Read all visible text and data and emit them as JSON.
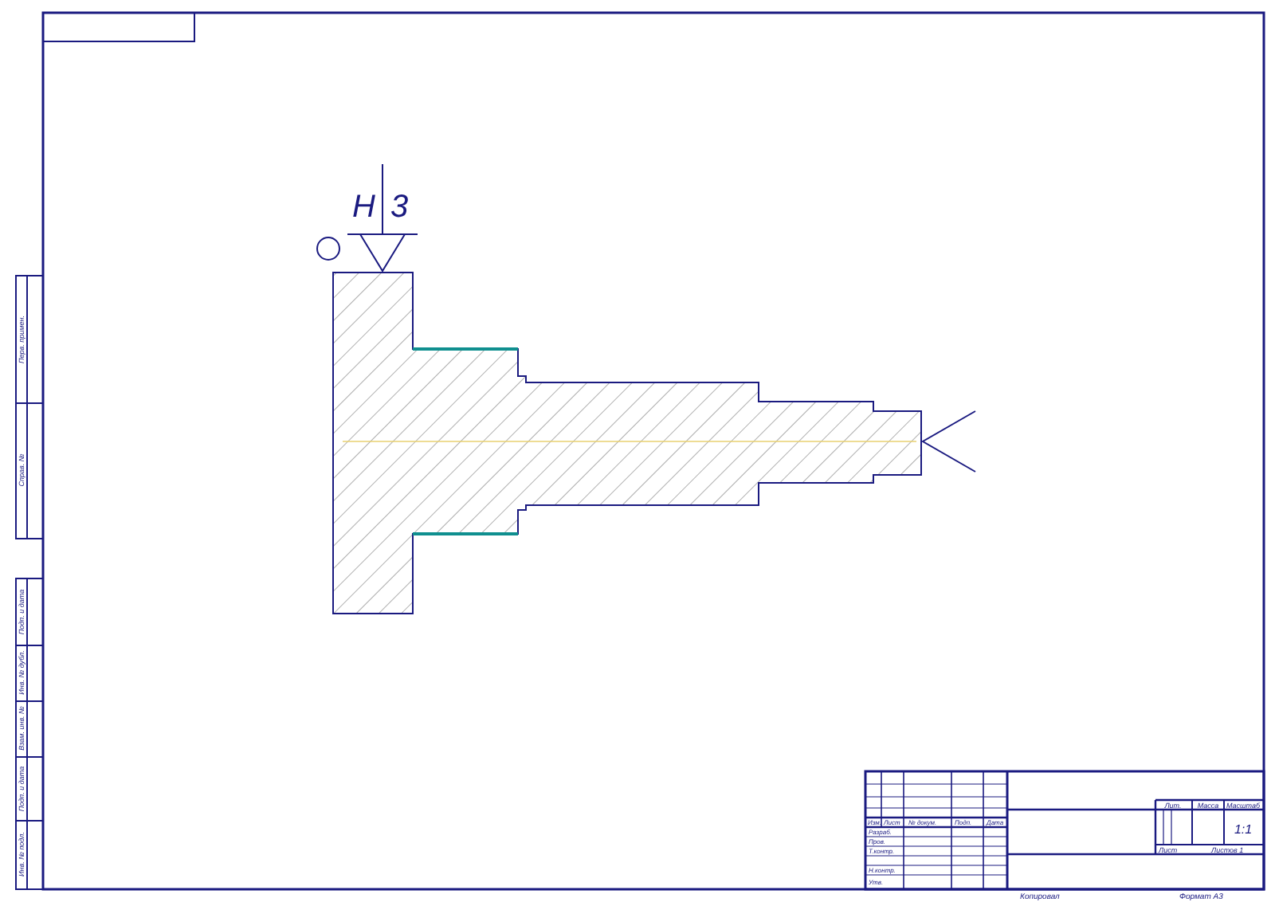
{
  "drawing": {
    "marks": [
      "Н",
      "3"
    ]
  },
  "side_stamps": [
    "Перв. примен.",
    "Справ. №",
    "Подп. и дата",
    "Инв. № дубл.",
    "Взам. инв. №",
    "Подп. и дата",
    "Инв. № подл."
  ],
  "title_block": {
    "header": [
      "Изм.",
      "Лист",
      "№ докум.",
      "Подп.",
      "Дата"
    ],
    "roles": [
      "Разраб.",
      "Пров.",
      "Т.контр.",
      "Н.контр.",
      "Утв."
    ],
    "info_headers": [
      "Лит.",
      "Масса",
      "Масштаб"
    ],
    "scale": "1:1",
    "sheet": "Лист",
    "sheets": "Листов 1",
    "copied": "Копировал",
    "format": "Формат A3"
  }
}
